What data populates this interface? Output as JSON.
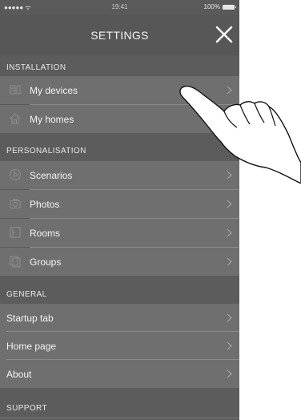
{
  "status": {
    "carrier": "●●●●● ᯤ",
    "time": "19:41",
    "battery": "100%"
  },
  "nav": {
    "title": "SETTINGS"
  },
  "installation": {
    "header": "INSTALLATION",
    "items": [
      {
        "label": "My devices",
        "icon": "devices-icon"
      },
      {
        "label": "My homes",
        "icon": "home-icon"
      }
    ]
  },
  "personalisation": {
    "header": "PERSONALISATION",
    "items": [
      {
        "label": "Scenarios",
        "icon": "play-icon"
      },
      {
        "label": "Photos",
        "icon": "camera-icon"
      },
      {
        "label": "Rooms",
        "icon": "door-icon"
      },
      {
        "label": "Groups",
        "icon": "group-icon"
      }
    ]
  },
  "general": {
    "header": "GENERAL",
    "items": [
      {
        "label": "Startup tab"
      },
      {
        "label": "Home page"
      },
      {
        "label": "About"
      }
    ]
  },
  "support": {
    "header": "SUPPORT"
  }
}
